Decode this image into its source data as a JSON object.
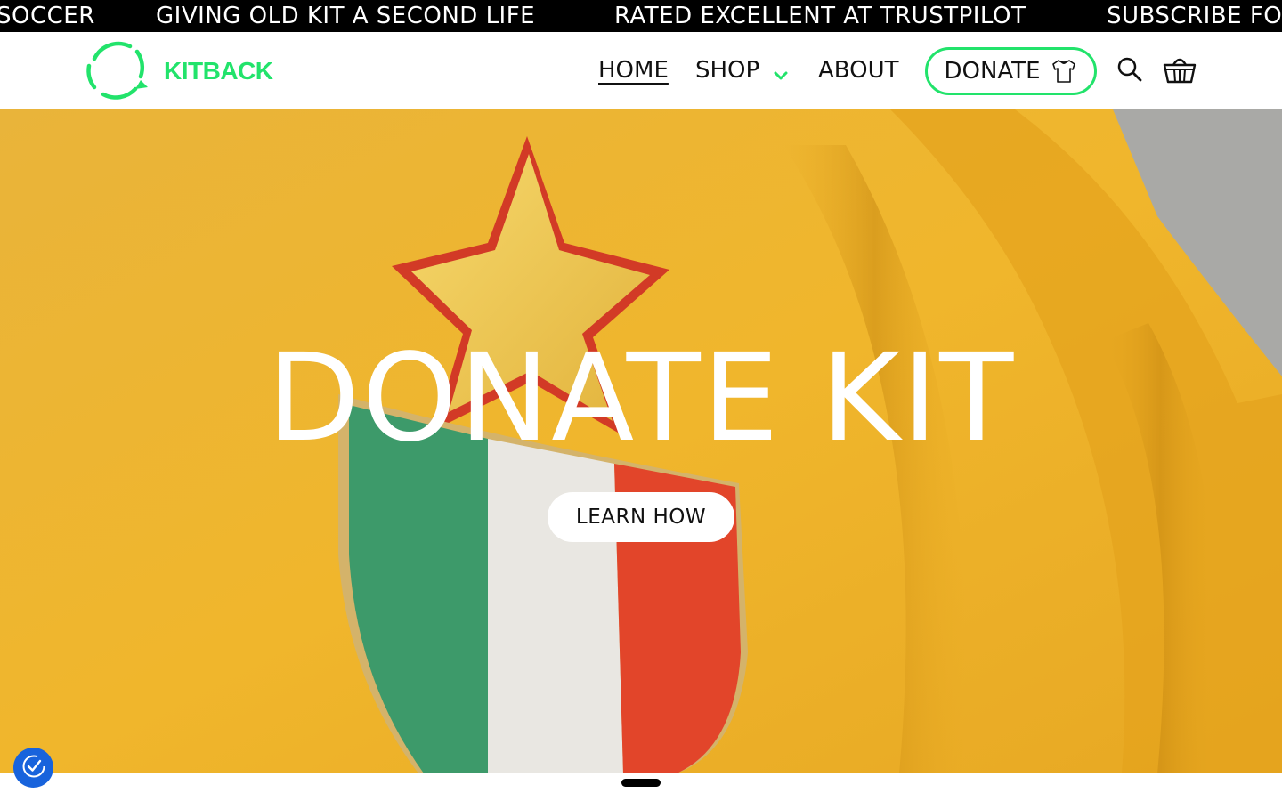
{
  "announcement": {
    "items": [
      "SOCCER",
      "GIVING OLD KIT A SECOND LIFE",
      "RATED EXCELLENT AT TRUSTPILOT",
      "SUBSCRIBE FO"
    ]
  },
  "header": {
    "logo_text": "KITBACK",
    "nav": {
      "home": "HOME",
      "shop": "SHOP",
      "about": "ABOUT"
    },
    "donate_label": "DONATE",
    "icons": {
      "logo": "circular-arrows-logo",
      "shop_chevron": "chevron-down-icon",
      "donate": "tshirt-icon",
      "search": "search-icon",
      "cart": "basket-icon"
    }
  },
  "hero": {
    "title": "DONATE KIT",
    "cta_label": "LEARN HOW",
    "image": "yellow-jersey-star-italy-shield-badge"
  },
  "carousel": {
    "active_slide_indicator": "bar"
  },
  "consent": {
    "icon": "cookie-consent-icon"
  },
  "colors": {
    "brand_green": "#22e36b",
    "ticker_bg": "#000000",
    "consent_blue": "#1863dc"
  }
}
